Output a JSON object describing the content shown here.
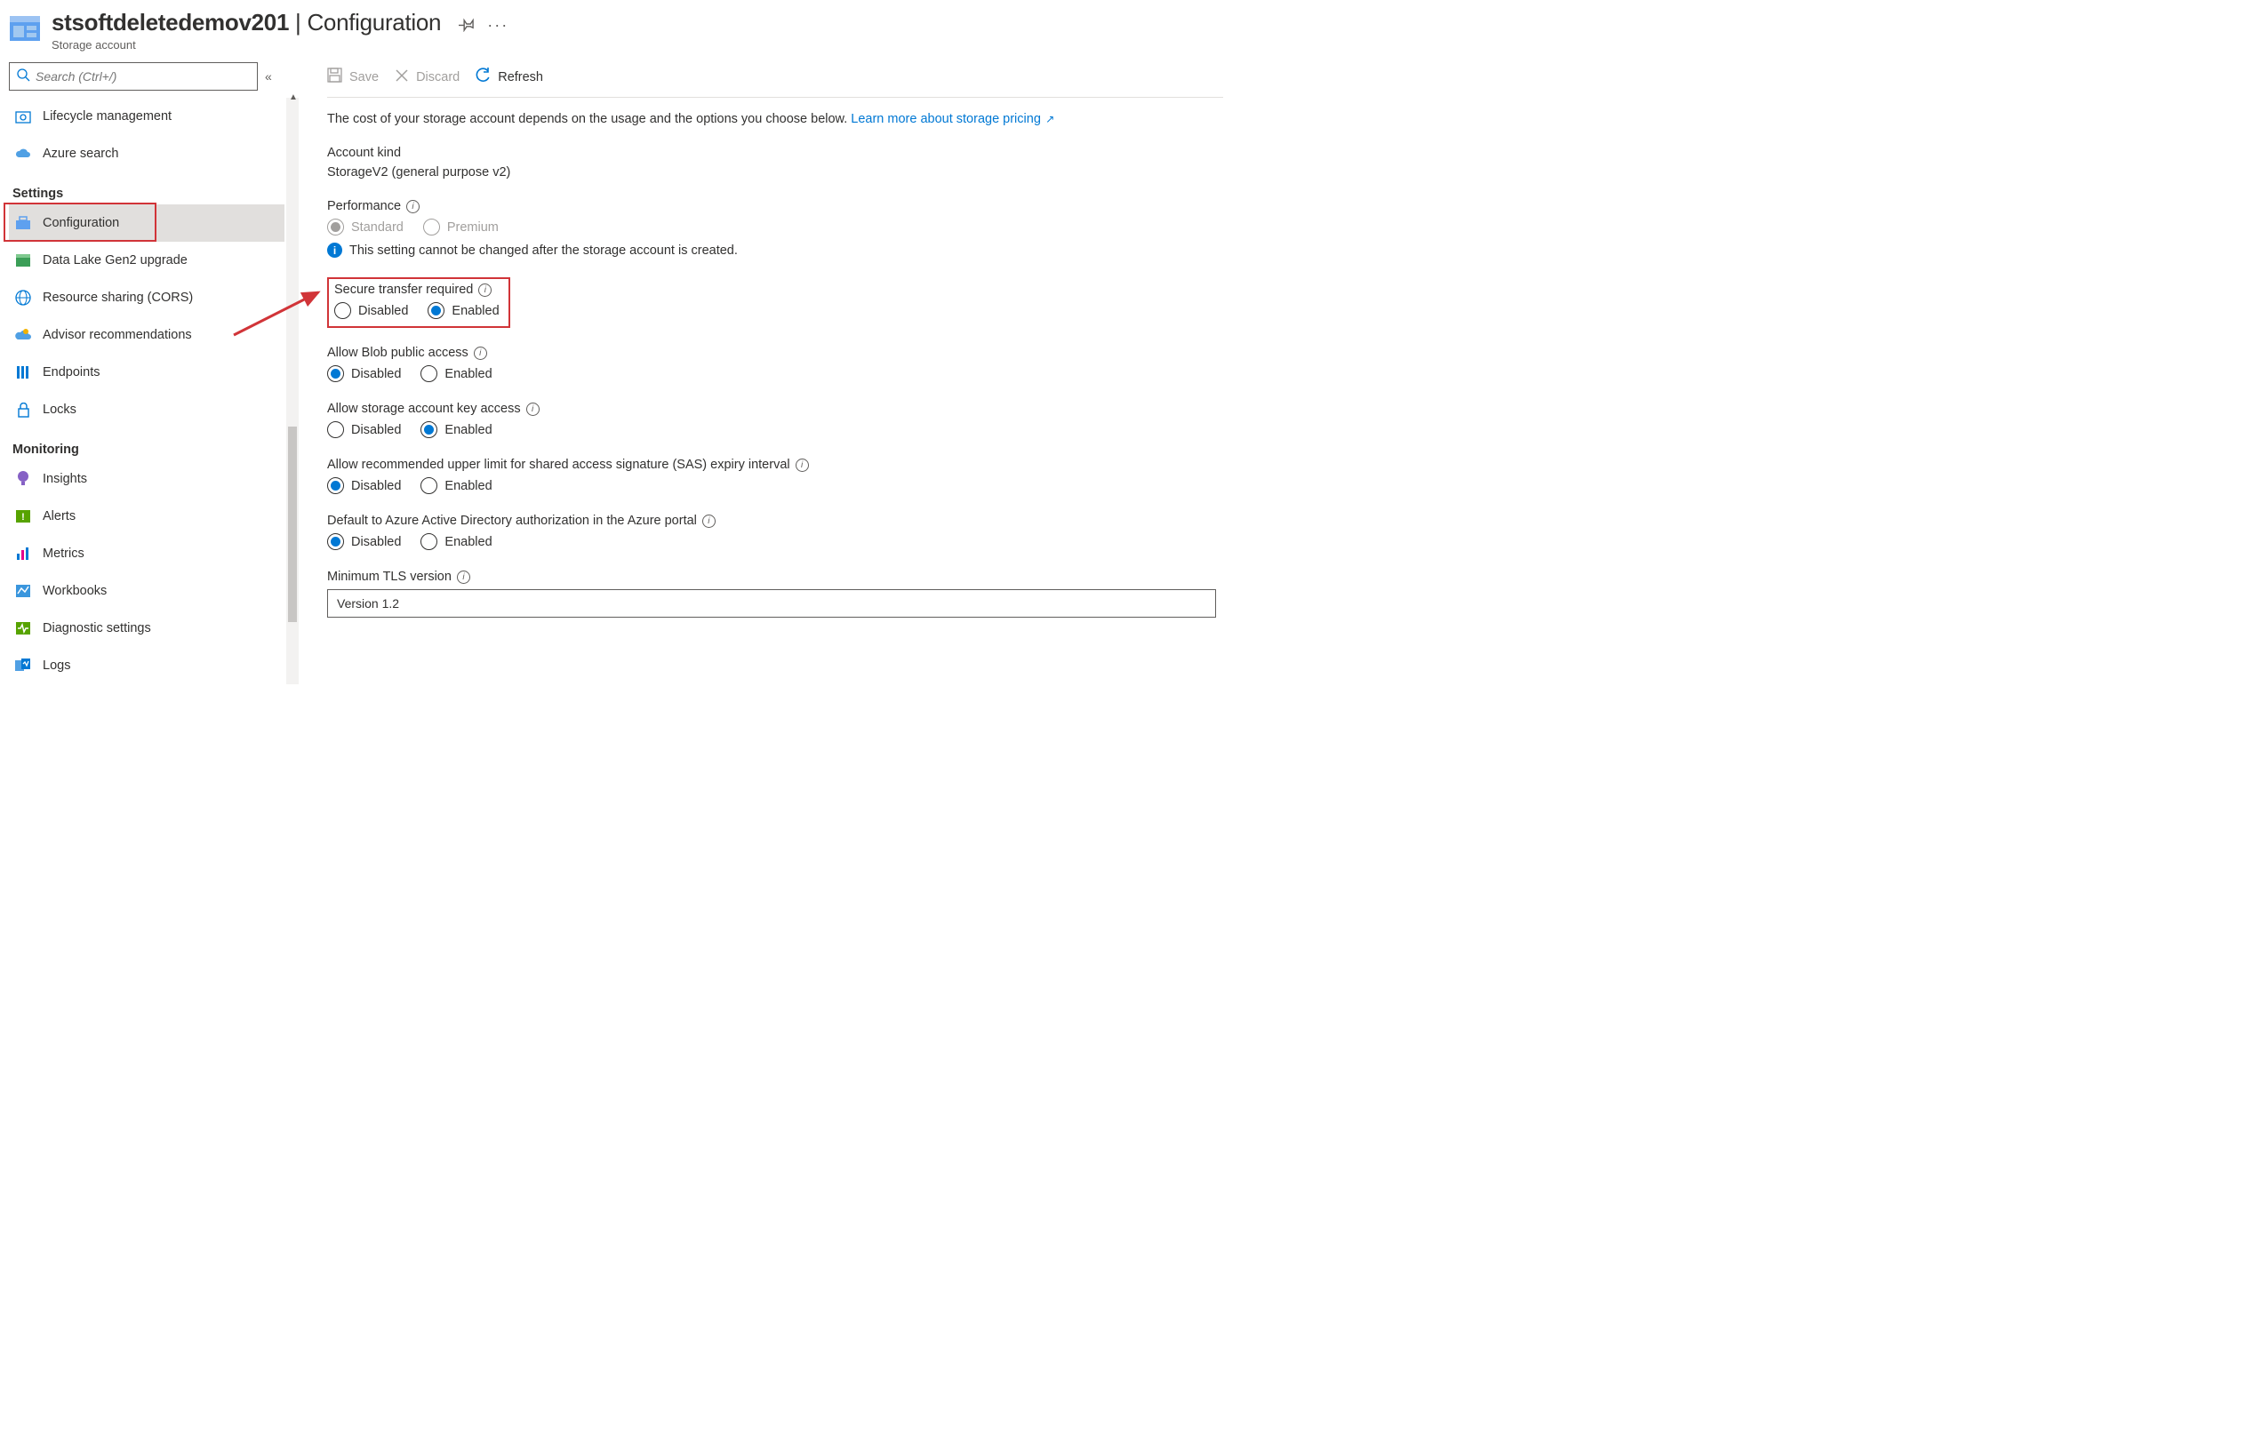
{
  "header": {
    "resource_name": "stsoftdeletedemov201",
    "section": "Configuration",
    "subtitle": "Storage account"
  },
  "sidebar": {
    "search_placeholder": "Search (Ctrl+/)",
    "items_top": [
      {
        "label": "Lifecycle management",
        "icon": "lifecycle"
      },
      {
        "label": "Azure search",
        "icon": "azuresearch"
      }
    ],
    "group_settings": "Settings",
    "items_settings": [
      {
        "label": "Configuration",
        "icon": "config",
        "active": true,
        "highlight": true
      },
      {
        "label": "Data Lake Gen2 upgrade",
        "icon": "datalake"
      },
      {
        "label": "Resource sharing (CORS)",
        "icon": "cors"
      },
      {
        "label": "Advisor recommendations",
        "icon": "advisor"
      },
      {
        "label": "Endpoints",
        "icon": "endpoints"
      },
      {
        "label": "Locks",
        "icon": "locks"
      }
    ],
    "group_monitoring": "Monitoring",
    "items_monitoring": [
      {
        "label": "Insights",
        "icon": "insights"
      },
      {
        "label": "Alerts",
        "icon": "alerts"
      },
      {
        "label": "Metrics",
        "icon": "metrics"
      },
      {
        "label": "Workbooks",
        "icon": "workbooks"
      },
      {
        "label": "Diagnostic settings",
        "icon": "diagnostic"
      },
      {
        "label": "Logs",
        "icon": "logs"
      }
    ]
  },
  "toolbar": {
    "save": "Save",
    "discard": "Discard",
    "refresh": "Refresh"
  },
  "main": {
    "description": "The cost of your storage account depends on the usage and the options you choose below. ",
    "learn_more": "Learn more about storage pricing",
    "account_kind_label": "Account kind",
    "account_kind_value": "StorageV2 (general purpose v2)",
    "performance_label": "Performance",
    "performance_note": "This setting cannot be changed after the storage account is created.",
    "opt_standard": "Standard",
    "opt_premium": "Premium",
    "opt_disabled": "Disabled",
    "opt_enabled": "Enabled",
    "secure_transfer_label": "Secure transfer required",
    "blob_public_label": "Allow Blob public access",
    "key_access_label": "Allow storage account key access",
    "sas_expiry_label": "Allow recommended upper limit for shared access signature (SAS) expiry interval",
    "aad_default_label": "Default to Azure Active Directory authorization in the Azure portal",
    "tls_label": "Minimum TLS version",
    "tls_value": "Version 1.2"
  }
}
